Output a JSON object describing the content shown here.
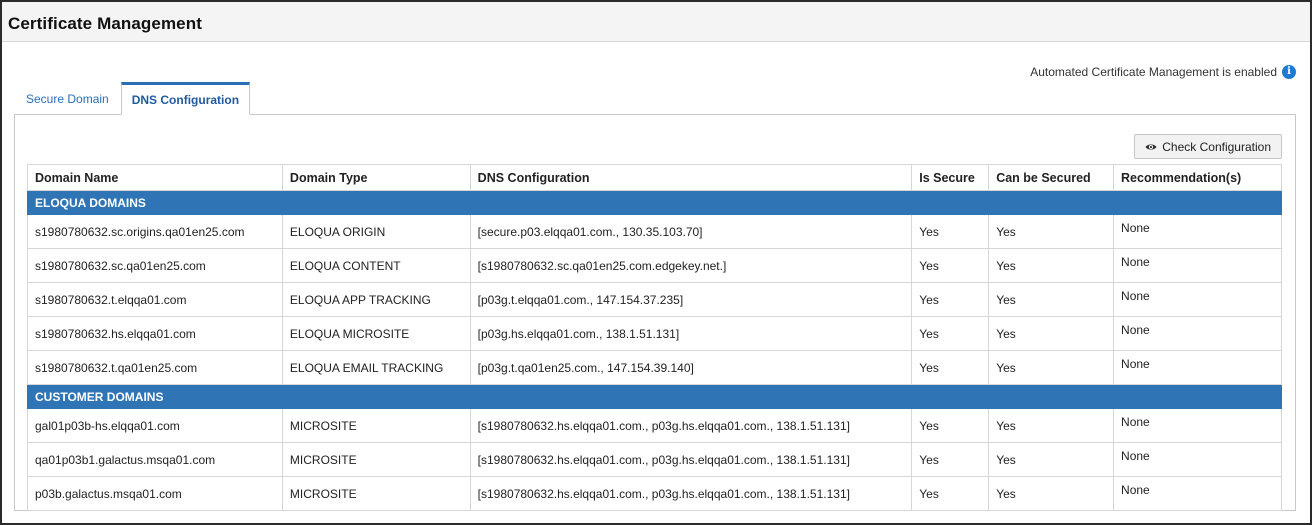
{
  "header": {
    "title": "Certificate Management"
  },
  "status": {
    "automated_text": "Automated Certificate Management is enabled",
    "info_icon": "info-icon"
  },
  "tabs": [
    {
      "label": "Secure Domain",
      "active": false
    },
    {
      "label": "DNS Configuration",
      "active": true
    }
  ],
  "toolbar": {
    "check_label": "Check Configuration",
    "check_icon": "eye-icon"
  },
  "colors": {
    "accent": "#2f75b5",
    "link": "#2a6eb5",
    "info": "#1f7ad1"
  },
  "table": {
    "columns": [
      "Domain Name",
      "Domain Type",
      "DNS Configuration",
      "Is Secure",
      "Can be Secured",
      "Recommendation(s)"
    ],
    "groups": [
      {
        "label": "ELOQUA DOMAINS",
        "rows": [
          [
            "s1980780632.sc.origins.qa01en25.com",
            "ELOQUA ORIGIN",
            "[secure.p03.elqqa01.com., 130.35.103.70]",
            "Yes",
            "Yes",
            "None"
          ],
          [
            "s1980780632.sc.qa01en25.com",
            "ELOQUA CONTENT",
            "[s1980780632.sc.qa01en25.com.edgekey.net.]",
            "Yes",
            "Yes",
            "None"
          ],
          [
            "s1980780632.t.elqqa01.com",
            "ELOQUA APP TRACKING",
            "[p03g.t.elqqa01.com., 147.154.37.235]",
            "Yes",
            "Yes",
            "None"
          ],
          [
            "s1980780632.hs.elqqa01.com",
            "ELOQUA MICROSITE",
            "[p03g.hs.elqqa01.com., 138.1.51.131]",
            "Yes",
            "Yes",
            "None"
          ],
          [
            "s1980780632.t.qa01en25.com",
            "ELOQUA EMAIL TRACKING",
            "[p03g.t.qa01en25.com., 147.154.39.140]",
            "Yes",
            "Yes",
            "None"
          ]
        ]
      },
      {
        "label": "CUSTOMER DOMAINS",
        "rows": [
          [
            "gal01p03b-hs.elqqa01.com",
            "MICROSITE",
            "[s1980780632.hs.elqqa01.com., p03g.hs.elqqa01.com., 138.1.51.131]",
            "Yes",
            "Yes",
            "None"
          ],
          [
            "qa01p03b1.galactus.msqa01.com",
            "MICROSITE",
            "[s1980780632.hs.elqqa01.com., p03g.hs.elqqa01.com., 138.1.51.131]",
            "Yes",
            "Yes",
            "None"
          ],
          [
            "p03b.galactus.msqa01.com",
            "MICROSITE",
            "[s1980780632.hs.elqqa01.com., p03g.hs.elqqa01.com., 138.1.51.131]",
            "Yes",
            "Yes",
            "None"
          ]
        ]
      }
    ]
  }
}
